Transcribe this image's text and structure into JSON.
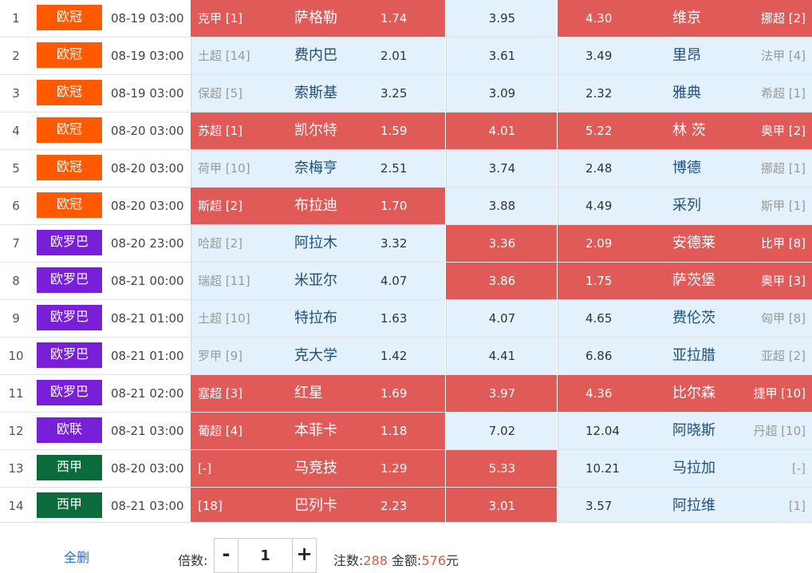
{
  "colors": {
    "selected": "#e05a58",
    "cell": "#e2f1fb"
  },
  "matches": [
    {
      "idx": "1",
      "comp": "欧冠",
      "comp_color": "#ff5a00",
      "time": "08-19 03:00",
      "home_rank": "克甲 [1]",
      "home": "萨格勒",
      "odd_win": "1.74",
      "odd_draw": "3.95",
      "odd_lose": "4.30",
      "away": "维京",
      "away_rank": "挪超 [2]",
      "sel": [
        true,
        false,
        true
      ]
    },
    {
      "idx": "2",
      "comp": "欧冠",
      "comp_color": "#ff5a00",
      "time": "08-19 03:00",
      "home_rank": "土超 [14]",
      "home": "费内巴",
      "odd_win": "2.01",
      "odd_draw": "3.61",
      "odd_lose": "3.49",
      "away": "里昂",
      "away_rank": "法甲 [4]",
      "sel": [
        false,
        false,
        false
      ]
    },
    {
      "idx": "3",
      "comp": "欧冠",
      "comp_color": "#ff5a00",
      "time": "08-19 03:00",
      "home_rank": "保超 [5]",
      "home": "索斯基",
      "odd_win": "3.25",
      "odd_draw": "3.09",
      "odd_lose": "2.32",
      "away": "雅典",
      "away_rank": "希超 [1]",
      "sel": [
        false,
        false,
        false
      ]
    },
    {
      "idx": "4",
      "comp": "欧冠",
      "comp_color": "#ff5a00",
      "time": "08-20 03:00",
      "home_rank": "苏超 [1]",
      "home": "凯尔特",
      "odd_win": "1.59",
      "odd_draw": "4.01",
      "odd_lose": "5.22",
      "away": "林 茨",
      "away_rank": "奥甲 [2]",
      "sel": [
        true,
        true,
        true
      ]
    },
    {
      "idx": "5",
      "comp": "欧冠",
      "comp_color": "#ff5a00",
      "time": "08-20 03:00",
      "home_rank": "荷甲 [10]",
      "home": "奈梅亨",
      "odd_win": "2.51",
      "odd_draw": "3.74",
      "odd_lose": "2.48",
      "away": "博德",
      "away_rank": "挪超 [1]",
      "sel": [
        false,
        false,
        false
      ]
    },
    {
      "idx": "6",
      "comp": "欧冠",
      "comp_color": "#ff5a00",
      "time": "08-20 03:00",
      "home_rank": "斯超 [2]",
      "home": "布拉迪",
      "odd_win": "1.70",
      "odd_draw": "3.88",
      "odd_lose": "4.49",
      "away": "采列",
      "away_rank": "斯甲 [1]",
      "sel": [
        true,
        false,
        false
      ]
    },
    {
      "idx": "7",
      "comp": "欧罗巴",
      "comp_color": "#7a1fd9",
      "time": "08-20 23:00",
      "home_rank": "哈超 [2]",
      "home": "阿拉木",
      "odd_win": "3.32",
      "odd_draw": "3.36",
      "odd_lose": "2.09",
      "away": "安德莱",
      "away_rank": "比甲 [8]",
      "sel": [
        false,
        true,
        true
      ]
    },
    {
      "idx": "8",
      "comp": "欧罗巴",
      "comp_color": "#7a1fd9",
      "time": "08-21 00:00",
      "home_rank": "瑞超 [11]",
      "home": "米亚尔",
      "odd_win": "4.07",
      "odd_draw": "3.86",
      "odd_lose": "1.75",
      "away": "萨茨堡",
      "away_rank": "奥甲 [3]",
      "sel": [
        false,
        true,
        true
      ]
    },
    {
      "idx": "9",
      "comp": "欧罗巴",
      "comp_color": "#7a1fd9",
      "time": "08-21 01:00",
      "home_rank": "土超 [10]",
      "home": "特拉布",
      "odd_win": "1.63",
      "odd_draw": "4.07",
      "odd_lose": "4.65",
      "away": "费伦茨",
      "away_rank": "匈甲 [8]",
      "sel": [
        false,
        false,
        false
      ]
    },
    {
      "idx": "10",
      "comp": "欧罗巴",
      "comp_color": "#7a1fd9",
      "time": "08-21 01:00",
      "home_rank": "罗甲 [9]",
      "home": "克大学",
      "odd_win": "1.42",
      "odd_draw": "4.41",
      "odd_lose": "6.86",
      "away": "亚拉腊",
      "away_rank": "亚超 [2]",
      "sel": [
        false,
        false,
        false
      ]
    },
    {
      "idx": "11",
      "comp": "欧罗巴",
      "comp_color": "#7a1fd9",
      "time": "08-21 02:00",
      "home_rank": "塞超 [3]",
      "home": "红星",
      "odd_win": "1.69",
      "odd_draw": "3.97",
      "odd_lose": "4.36",
      "away": "比尔森",
      "away_rank": "捷甲 [10]",
      "sel": [
        true,
        true,
        true
      ]
    },
    {
      "idx": "12",
      "comp": "欧联",
      "comp_color": "#7a1fd9",
      "time": "08-21 03:00",
      "home_rank": "葡超 [4]",
      "home": "本菲卡",
      "odd_win": "1.18",
      "odd_draw": "7.02",
      "odd_lose": "12.04",
      "away": "阿晓斯",
      "away_rank": "丹超 [10]",
      "sel": [
        true,
        false,
        false
      ]
    },
    {
      "idx": "13",
      "comp": "西甲",
      "comp_color": "#0b6b3a",
      "time": "08-20 03:00",
      "home_rank": "[-]",
      "home": "马竞技",
      "odd_win": "1.29",
      "odd_draw": "5.33",
      "odd_lose": "10.21",
      "away": "马拉加",
      "away_rank": "[-]",
      "sel": [
        true,
        true,
        false
      ]
    },
    {
      "idx": "14",
      "comp": "西甲",
      "comp_color": "#0b6b3a",
      "time": "08-21 03:00",
      "home_rank": "[18]",
      "home": "巴列卡",
      "odd_win": "2.23",
      "odd_draw": "3.01",
      "odd_lose": "3.57",
      "away": "阿拉维",
      "away_rank": "[1]",
      "sel": [
        true,
        true,
        false
      ]
    }
  ],
  "footer": {
    "clear_label": "全删",
    "multiplier_label": "倍数:",
    "minus": "-",
    "plus": "+",
    "multiplier_value": "1",
    "count_label": "注数:",
    "count": "288",
    "amount_label": "金额:",
    "amount": "576",
    "amount_unit": "元"
  }
}
